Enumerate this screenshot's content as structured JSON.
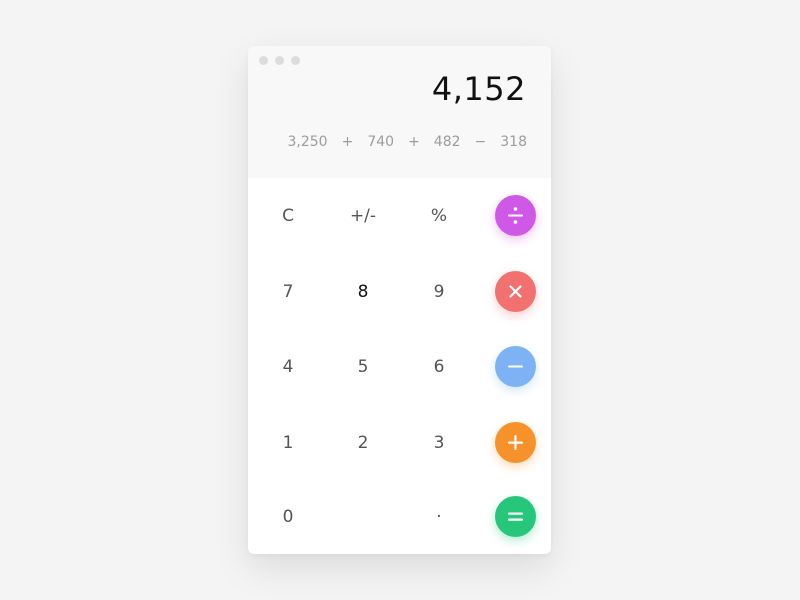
{
  "display": {
    "result": "4,152",
    "expression": [
      "3,250",
      "+",
      "740",
      "+",
      "482",
      "−",
      "318"
    ]
  },
  "keys": {
    "clear": "C",
    "sign": "+/-",
    "percent": "%",
    "seven": "7",
    "eight": "8",
    "nine": "9",
    "four": "4",
    "five": "5",
    "six": "6",
    "one": "1",
    "two": "2",
    "three": "3",
    "zero": "0",
    "decimal": "·"
  },
  "operators": [
    {
      "name": "divide",
      "icon": "divide-icon",
      "color": "#cf58e6"
    },
    {
      "name": "multiply",
      "icon": "multiply-icon",
      "color": "#f0716f"
    },
    {
      "name": "subtract",
      "icon": "minus-icon",
      "color": "#7db3f5"
    },
    {
      "name": "add",
      "icon": "plus-icon",
      "color": "#f7922a"
    },
    {
      "name": "equals",
      "icon": "equals-icon",
      "color": "#27c77b"
    }
  ],
  "colors": {
    "background": "#f4f4f4",
    "display_background": "#f8f8f8",
    "panel": "#ffffff",
    "result_text": "#111111",
    "expression_text": "#9c9c9c"
  }
}
